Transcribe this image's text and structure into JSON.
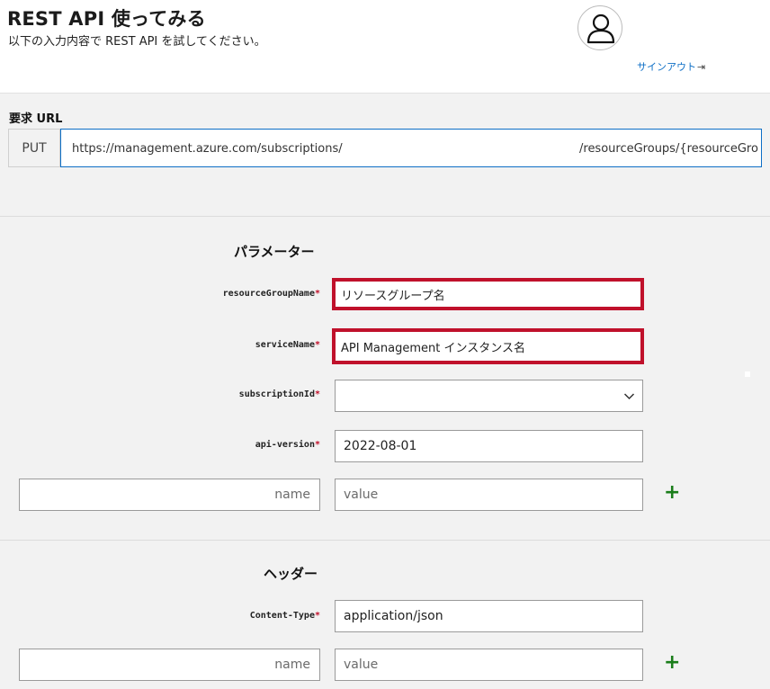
{
  "header": {
    "title": "REST API 使ってみる",
    "subtitle": "以下の入力内容で REST API を試してください。",
    "signout_label": "サインアウト",
    "signout_icon": "sign-out-icon"
  },
  "request": {
    "label": "要求 URL",
    "method": "PUT",
    "url_left": "https://management.azure.com/subscriptions/",
    "url_right": "/resourceGroups/{resourceGro"
  },
  "parameters": {
    "title": "パラメーター",
    "required_mark": "*",
    "rows": [
      {
        "label": "resourceGroupName",
        "value": "リソースグループ名"
      },
      {
        "label": "serviceName",
        "value": "API Management インスタンス名"
      },
      {
        "label": "subscriptionId",
        "value": ""
      },
      {
        "label": "api-version",
        "value": "2022-08-01"
      }
    ],
    "new_name_placeholder": "name",
    "new_value_placeholder": "value",
    "add_label": "+"
  },
  "headers": {
    "title": "ヘッダー",
    "rows": [
      {
        "label": "Content-Type",
        "value": "application/json"
      }
    ],
    "new_name_placeholder": "name",
    "new_value_placeholder": "value",
    "add_label": "+"
  },
  "colors": {
    "accent": "#0e6fc6",
    "highlight": "#c0112b",
    "add": "#1a7d1a"
  }
}
